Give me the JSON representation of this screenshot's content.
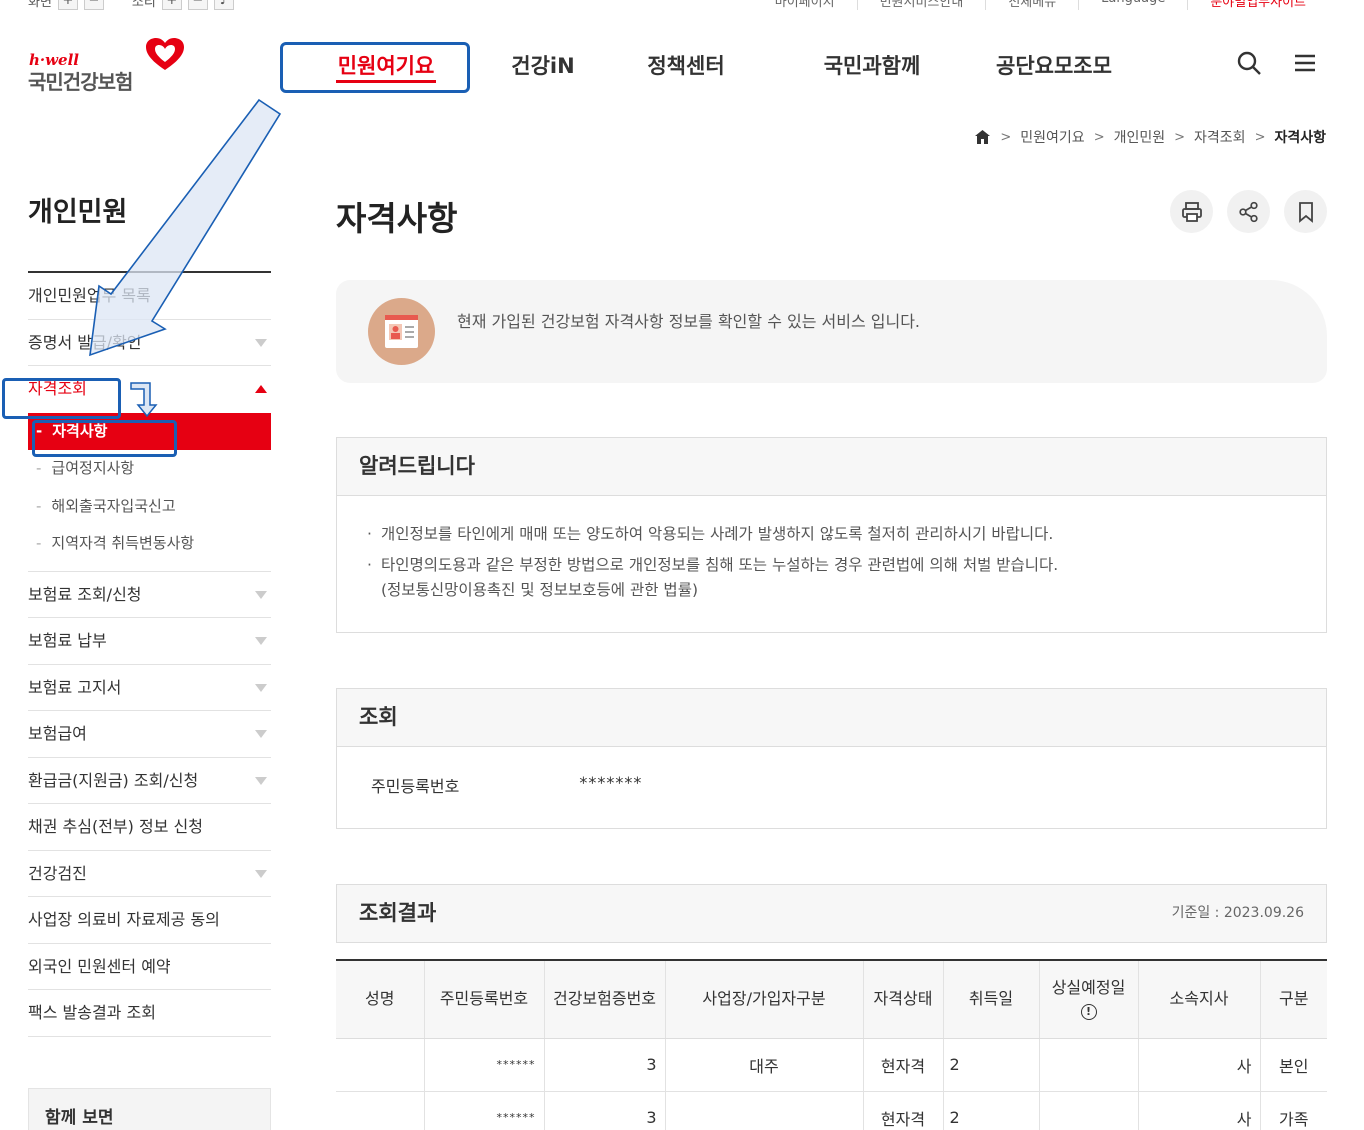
{
  "util": {
    "zoom_label": "화면",
    "sound_label": "소리",
    "links": [
      "마이페이지",
      "민원서비스안내",
      "전체메뉴",
      "Language",
      "분야별업무사이트"
    ]
  },
  "logo": {
    "hwell": "h·well",
    "name": "국민건강보험"
  },
  "gnb": [
    "민원여기요",
    "건강iN",
    "정책센터",
    "국민과함께",
    "공단요모조모"
  ],
  "breadcrumb": [
    "민원여기요",
    "개인민원",
    "자격조회",
    "자격사항"
  ],
  "lnb": {
    "title": "개인민원",
    "items": [
      "개인민원업무 목록",
      "증명서 발급/확인",
      "자격조회",
      "보험료 조회/신청",
      "보험료 납부",
      "보험료 고지서",
      "보험급여",
      "환급금(지원금) 조회/신청",
      "채권 추심(전부) 정보 신청",
      "건강검진",
      "사업장 의료비 자료제공 동의",
      "외국인 민원센터 예약",
      "팩스 발송결과 조회"
    ],
    "sub_items": [
      "자격사항",
      "급여정지사항",
      "해외출국자입국신고",
      "지역자격 취득변동사항"
    ],
    "see_also": "함께 보면"
  },
  "page": {
    "title": "자격사항",
    "intro": "현재 가입된 건강보험 자격사항 정보를 확인할 수 있는 서비스 입니다."
  },
  "notice": {
    "title": "알려드립니다",
    "items": [
      "개인정보를 타인에게 매매 또는 양도하여 악용되는 사례가 발생하지 않도록 철저히 관리하시기 바랍니다.",
      "타인명의도용과 같은 부정한 방법으로 개인정보를 침해 또는 누설하는 경우 관련법에 의해 처벌 받습니다."
    ],
    "law": "(정보통신망이용촉진 및 정보보호등에 관한 법률)"
  },
  "query": {
    "title": "조회",
    "label": "주민등록번호",
    "value": "*******"
  },
  "result": {
    "title": "조회결과",
    "date": "기준일 : 2023.09.26",
    "columns": [
      "성명",
      "주민등록번호",
      "건강보험증번호",
      "사업장/가입자구분",
      "자격상태",
      "취득일",
      "상실예정일",
      "소속지사",
      "구분"
    ],
    "rows": [
      [
        "",
        "******",
        "3",
        "대주",
        "현자격",
        "2",
        "",
        "사",
        "본인"
      ],
      [
        "",
        "******",
        "3",
        "",
        "현자격",
        "2",
        "",
        "사",
        "가족"
      ]
    ]
  },
  "colors": {
    "brand_red": "#e60012",
    "annotation_blue": "#1a5fb4"
  }
}
